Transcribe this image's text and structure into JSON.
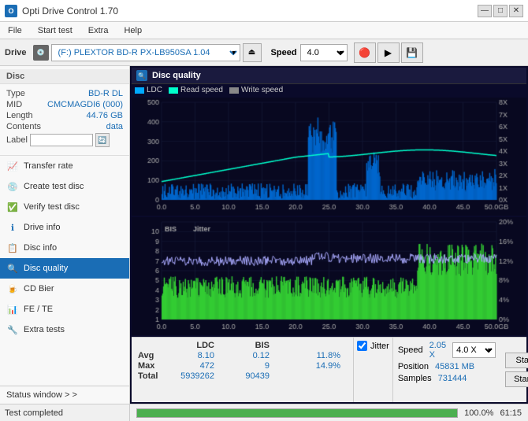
{
  "app": {
    "title": "Opti Drive Control 1.70",
    "icon": "O"
  },
  "titlebar": {
    "minimize": "—",
    "maximize": "□",
    "close": "✕"
  },
  "menu": {
    "items": [
      "File",
      "Start test",
      "Extra",
      "Help"
    ]
  },
  "toolbar": {
    "drive_label": "Drive",
    "drive_icon": "💿",
    "drive_value": "(F:)  PLEXTOR BD-R  PX-LB950SA 1.04",
    "speed_label": "Speed",
    "speed_value": "4.0 X",
    "eject_icon": "⏏",
    "icons": [
      "🔴",
      "🟢",
      "💾"
    ]
  },
  "disc": {
    "section_title": "Disc",
    "type_label": "Type",
    "type_value": "BD-R DL",
    "mid_label": "MID",
    "mid_value": "CMCMAGDI6 (000)",
    "length_label": "Length",
    "length_value": "44.76 GB",
    "contents_label": "Contents",
    "contents_value": "data",
    "label_label": "Label",
    "label_value": ""
  },
  "sidebar_nav": [
    {
      "id": "transfer-rate",
      "label": "Transfer rate",
      "icon": "📈"
    },
    {
      "id": "create-test-disc",
      "label": "Create test disc",
      "icon": "💿"
    },
    {
      "id": "verify-test-disc",
      "label": "Verify test disc",
      "icon": "✅"
    },
    {
      "id": "drive-info",
      "label": "Drive info",
      "icon": "ℹ"
    },
    {
      "id": "disc-info",
      "label": "Disc info",
      "icon": "📋"
    },
    {
      "id": "disc-quality",
      "label": "Disc quality",
      "icon": "🔍",
      "active": true
    },
    {
      "id": "cd-bier",
      "label": "CD Bier",
      "icon": "🍺"
    },
    {
      "id": "fe-te",
      "label": "FE / TE",
      "icon": "📊"
    },
    {
      "id": "extra-tests",
      "label": "Extra tests",
      "icon": "🔧"
    }
  ],
  "disc_quality": {
    "header": "Disc quality",
    "legend": {
      "ldc_label": "LDC",
      "ldc_color": "#00aaff",
      "read_speed_label": "Read speed",
      "read_speed_color": "#00ffcc",
      "write_speed_label": "Write speed",
      "write_speed_color": "#aaaaaa"
    },
    "chart1": {
      "y_max": 500,
      "y_right_max": 8,
      "x_max": 50,
      "x_label": "GB",
      "y_right_label": "X"
    },
    "chart2": {
      "y_max": 10,
      "y_right_max": 20,
      "x_max": 50,
      "x_label": "GB",
      "y_right_label": "%",
      "header": "BIS",
      "header2": "Jitter"
    }
  },
  "stats": {
    "col_headers": [
      "",
      "LDC",
      "BIS",
      "",
      "Jitter"
    ],
    "rows": [
      {
        "label": "Avg",
        "ldc": "8.10",
        "bis": "0.12",
        "jitter": "11.8%"
      },
      {
        "label": "Max",
        "ldc": "472",
        "bis": "9",
        "jitter": "14.9%"
      },
      {
        "label": "Total",
        "ldc": "5939262",
        "bis": "90439",
        "jitter": ""
      }
    ],
    "speed_label": "Speed",
    "speed_value": "2.05 X",
    "speed_dropdown": "4.0 X",
    "position_label": "Position",
    "position_value": "45831 MB",
    "samples_label": "Samples",
    "samples_value": "731444",
    "jitter_checked": true,
    "jitter_label": "Jitter",
    "start_full_label": "Start full",
    "start_part_label": "Start part"
  },
  "statusbar": {
    "left_text": "Test completed",
    "status_window": "Status window > >",
    "progress": 100,
    "progress_text": "100.0%",
    "time_text": "61:15"
  }
}
